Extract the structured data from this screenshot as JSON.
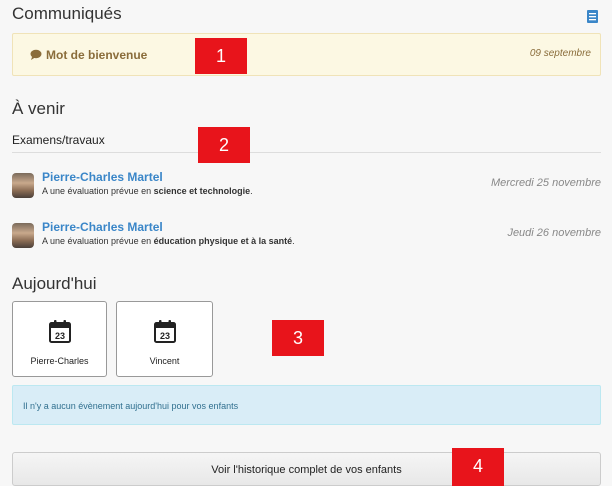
{
  "communiques": {
    "title": "Communiqués",
    "notice": {
      "label": "Mot de bienvenue",
      "date": "09 septembre"
    }
  },
  "upcoming": {
    "title": "À venir",
    "subtitle": "Examens/travaux",
    "items": [
      {
        "name": "Pierre-Charles Martel",
        "desc_prefix": "A une évaluation prévue en ",
        "subject": "science et technologie",
        "desc_suffix": ".",
        "date": "Mercredi 25 novembre"
      },
      {
        "name": "Pierre-Charles Martel",
        "desc_prefix": "A une évaluation prévue en ",
        "subject": "éducation physique et à la santé",
        "desc_suffix": ".",
        "date": "Jeudi 26 novembre"
      }
    ]
  },
  "today": {
    "title": "Aujourd'hui",
    "children": [
      {
        "label": "Pierre-Charles",
        "calendar_day": "23"
      },
      {
        "label": "Vincent",
        "calendar_day": "23"
      }
    ],
    "empty_message": "Il n'y a aucun évènement aujourd'hui pour vos enfants"
  },
  "history_button_label": "Voir l'historique complet de vos enfants",
  "markers": [
    "1",
    "2",
    "3",
    "4"
  ],
  "colors": {
    "link": "#3a86c8",
    "notice_bg": "#fcf8e3",
    "info_bg": "#d9edf7",
    "marker": "#e8141b"
  }
}
